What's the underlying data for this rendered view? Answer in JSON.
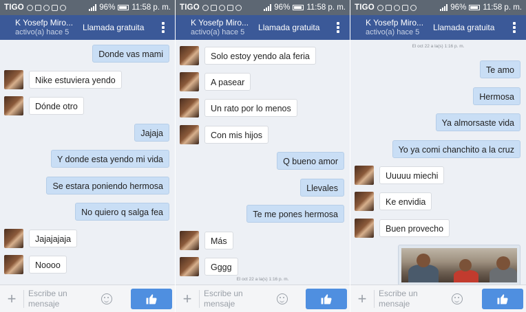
{
  "status": {
    "carrier": "TIGO",
    "battery": "96%",
    "time": "11:58 p. m."
  },
  "header": {
    "name": "K Yosefp Miro...",
    "active": "activo(a) hace 5",
    "call": "Llamada gratuita"
  },
  "input": {
    "placeholder": "Escribe un mensaje"
  },
  "timestamps": {
    "oct22": "El oct 22 a la(s) 1:16 p. m."
  },
  "screens": [
    {
      "messages": [
        {
          "dir": "out",
          "text": "Donde vas mami"
        },
        {
          "dir": "in",
          "text": "Nike estuviera yendo"
        },
        {
          "dir": "in",
          "text": "Dónde otro"
        },
        {
          "dir": "out",
          "text": "Jajaja"
        },
        {
          "dir": "out",
          "text": "Y donde esta yendo mi vida"
        },
        {
          "dir": "out",
          "text": "Se estara poniendo hermosa"
        },
        {
          "dir": "out",
          "text": "No quiero q salga fea"
        },
        {
          "dir": "in",
          "text": "Jajajajaja"
        },
        {
          "dir": "in",
          "text": "Noooo"
        }
      ]
    },
    {
      "messages": [
        {
          "dir": "in",
          "text": "Solo estoy yendo ala feria"
        },
        {
          "dir": "in",
          "text": "A pasear"
        },
        {
          "dir": "in",
          "text": "Un rato por lo menos"
        },
        {
          "dir": "in",
          "text": "Con mis hijos"
        },
        {
          "dir": "out",
          "text": "Q bueno amor"
        },
        {
          "dir": "out",
          "text": "Llevales"
        },
        {
          "dir": "out",
          "text": "Te me pones hermosa"
        },
        {
          "dir": "in",
          "text": "Más"
        },
        {
          "dir": "in",
          "text": "Gggg"
        }
      ]
    },
    {
      "messages": [
        {
          "dir": "out",
          "text": "Te amo"
        },
        {
          "dir": "out",
          "text": "Hermosa"
        },
        {
          "dir": "out",
          "text": "Ya almorsaste vida"
        },
        {
          "dir": "out",
          "text": "Yo ya comi chanchito a la cruz"
        },
        {
          "dir": "in",
          "text": "Uuuuu miechi"
        },
        {
          "dir": "in",
          "text": "Ke envidia"
        },
        {
          "dir": "in",
          "text": "Buen provecho"
        }
      ]
    }
  ]
}
